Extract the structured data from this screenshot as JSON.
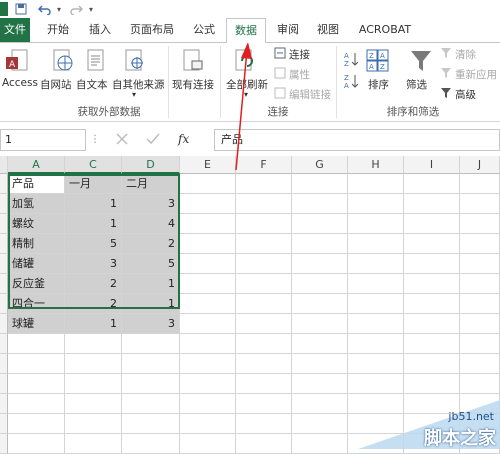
{
  "qat": {
    "file_tab": "文件"
  },
  "tabs": [
    "开始",
    "插入",
    "页面布局",
    "公式",
    "数据",
    "审阅",
    "视图",
    "ACROBAT"
  ],
  "ribbon": {
    "access": "Access",
    "web": "自网站",
    "text": "自文本",
    "other": "自其他来源",
    "existing": "现有连接",
    "refresh_all": "全部刷新",
    "conn": "连接",
    "props": "属性",
    "editlinks": "编辑链接",
    "sort": "排序",
    "filter": "筛选",
    "clear": "清除",
    "reapply": "重新应用",
    "advanced": "高级",
    "g_external": "获取外部数据",
    "g_conn": "连接",
    "g_sort": "排序和筛选"
  },
  "formula": {
    "namebox": "1",
    "fx": "fx",
    "content": "产品"
  },
  "columns": [
    "A",
    "C",
    "D",
    "E",
    "F",
    "G",
    "H",
    "I",
    "J"
  ],
  "table": {
    "header": [
      "产品",
      "一月",
      "二月"
    ],
    "rows": [
      [
        "加氢",
        "1",
        "3"
      ],
      [
        "螺纹",
        "1",
        "4"
      ],
      [
        "精制",
        "5",
        "2"
      ],
      [
        "储罐",
        "3",
        "5"
      ],
      [
        "反应釜",
        "2",
        "1"
      ],
      [
        "四合一",
        "2",
        "1"
      ],
      [
        "球罐",
        "1",
        "3"
      ]
    ]
  },
  "watermark": {
    "site": "jb51.net",
    "brand": "脚本之家"
  }
}
